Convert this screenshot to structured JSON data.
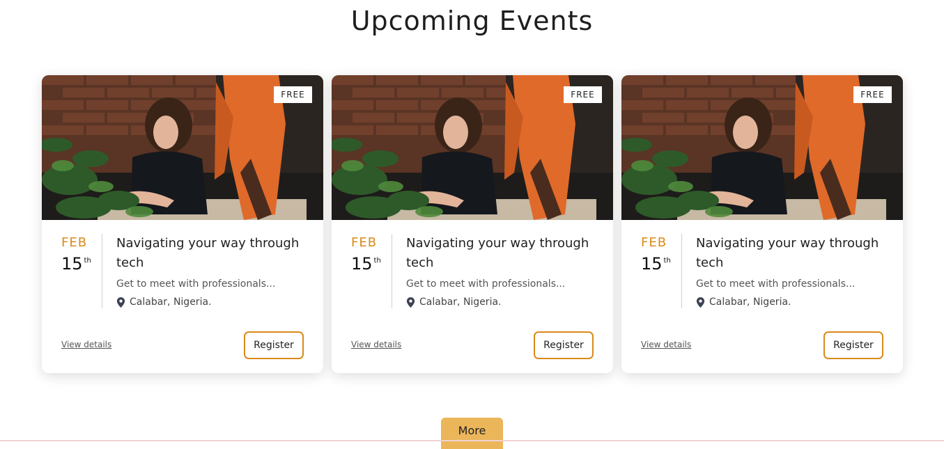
{
  "section": {
    "title": "Upcoming Events"
  },
  "events": [
    {
      "badge": "FREE",
      "month": "FEB",
      "day": "15",
      "day_suffix": "th",
      "title": "Navigating your way through tech",
      "description": "Get to meet with professionals...",
      "location": "Calabar, Nigeria.",
      "view_details_label": "View details",
      "register_label": "Register"
    },
    {
      "badge": "FREE",
      "month": "FEB",
      "day": "15",
      "day_suffix": "th",
      "title": "Navigating your way through tech",
      "description": "Get to meet with professionals...",
      "location": "Calabar, Nigeria.",
      "view_details_label": "View details",
      "register_label": "Register"
    },
    {
      "badge": "FREE",
      "month": "FEB",
      "day": "15",
      "day_suffix": "th",
      "title": "Navigating your way through tech",
      "description": "Get to meet with professionals...",
      "location": "Calabar, Nigeria.",
      "view_details_label": "View details",
      "register_label": "Register"
    }
  ],
  "more_label": "More",
  "colors": {
    "accent": "#d98a1a",
    "more_button": "#ebb55a"
  },
  "icons": {
    "location": "location-pin-icon"
  }
}
